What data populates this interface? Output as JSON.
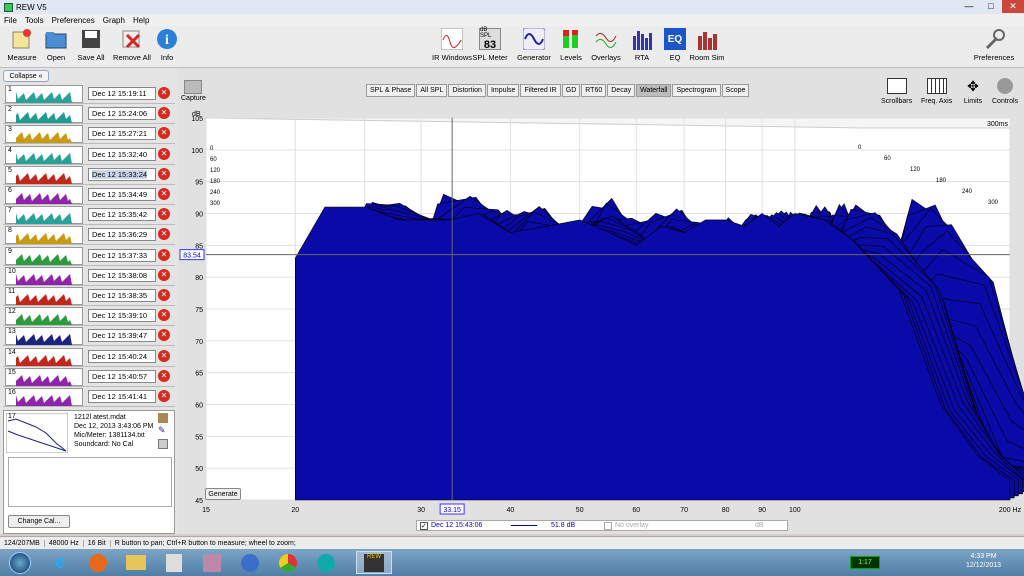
{
  "window": {
    "title": "REW V5",
    "min": "—",
    "max": "□",
    "close": "✕"
  },
  "menu": [
    "File",
    "Tools",
    "Preferences",
    "Graph",
    "Help"
  ],
  "toolbar_left": [
    {
      "label": "Measure",
      "icon": "measure-icon"
    },
    {
      "label": "Open",
      "icon": "folder-open-icon"
    },
    {
      "label": "Save All",
      "icon": "save-icon"
    },
    {
      "label": "Remove All",
      "icon": "remove-all-icon"
    },
    {
      "label": "Info",
      "icon": "info-icon"
    }
  ],
  "toolbar_center": [
    {
      "label": "IR Windows",
      "icon": "ir-windows-icon"
    },
    {
      "label": "SPL Meter",
      "icon": "spl-meter-icon",
      "display_top": "dB SPL",
      "display_val": "83"
    },
    {
      "label": "Generator",
      "icon": "generator-icon"
    },
    {
      "label": "Levels",
      "icon": "levels-icon"
    },
    {
      "label": "Overlays",
      "icon": "overlays-icon"
    },
    {
      "label": "RTA",
      "icon": "rta-icon"
    },
    {
      "label": "EQ",
      "icon": "eq-icon"
    },
    {
      "label": "Room Sim",
      "icon": "room-sim-icon"
    }
  ],
  "preferences_label": "Preferences",
  "collapse_label": "Collapse",
  "measurements": [
    {
      "num": "1",
      "time": "Dec 12 15:19:11",
      "color": "#2aa198"
    },
    {
      "num": "2",
      "time": "Dec 12 15:24:06",
      "color": "#1f9c8f"
    },
    {
      "num": "3",
      "time": "Dec 12 15:27:21",
      "color": "#c79a12"
    },
    {
      "num": "4",
      "time": "Dec 12 15:32:40",
      "color": "#2aa198"
    },
    {
      "num": "5",
      "time": "Dec 12 15:33:24",
      "color": "#c2271c"
    },
    {
      "num": "6",
      "time": "Dec 12 15:34:49",
      "color": "#8e24aa"
    },
    {
      "num": "7",
      "time": "Dec 12 15:35:42",
      "color": "#2aa198"
    },
    {
      "num": "8",
      "time": "Dec 12 15:36:29",
      "color": "#c79a12"
    },
    {
      "num": "9",
      "time": "Dec 12 15:37:33",
      "color": "#2e9a3f"
    },
    {
      "num": "10",
      "time": "Dec 12 15:38:08",
      "color": "#8e24aa"
    },
    {
      "num": "11",
      "time": "Dec 12 15:38:35",
      "color": "#c2271c"
    },
    {
      "num": "12",
      "time": "Dec 12 15:39:10",
      "color": "#2e9a3f"
    },
    {
      "num": "13",
      "time": "Dec 12 15:39:47",
      "color": "#1a237e"
    },
    {
      "num": "14",
      "time": "Dec 12 15:40:24",
      "color": "#c2271c"
    },
    {
      "num": "15",
      "time": "Dec 12 15:40:57",
      "color": "#8e24aa"
    },
    {
      "num": "16",
      "time": "Dec 12 15:41:41",
      "color": "#8e24aa"
    },
    {
      "num": "17",
      "time": "Dec 12 15:43:06",
      "color": "#1a237e"
    }
  ],
  "selected_info": {
    "num": "17",
    "file": "1212l atest.mdat",
    "date": "Dec 12, 2013 3:43:06 PM",
    "mic": "Mic/Meter: 1381134.txt",
    "soundcard": "Soundcard: No Cal",
    "change_cal": "Change Cal..."
  },
  "capture_label": "Capture",
  "tabs": [
    "SPL & Phase",
    "All SPL",
    "Distortion",
    "Impulse",
    "Filtered IR",
    "GD",
    "RT60",
    "Decay",
    "Waterfall",
    "Spectrogram",
    "Scope"
  ],
  "active_tab": "Waterfall",
  "right_tools": [
    {
      "label": "Scrollbars",
      "icon": "scrollbars-icon"
    },
    {
      "label": "Freq. Axis",
      "icon": "freq-axis-icon"
    },
    {
      "label": "Limits",
      "icon": "limits-icon"
    },
    {
      "label": "Controls",
      "icon": "controls-icon"
    }
  ],
  "chart_data": {
    "type": "area",
    "subtype": "waterfall",
    "ylabel": "dB",
    "ylim": [
      45,
      105
    ],
    "yticks": [
      "105",
      "100",
      "95",
      "90",
      "85",
      "80",
      "75",
      "70",
      "65",
      "60",
      "55",
      "50",
      "45"
    ],
    "xscale": "log",
    "xlim": [
      15,
      200
    ],
    "xticks": [
      "15",
      "20",
      "",
      "30",
      "40",
      "50",
      "60",
      "70",
      "80",
      "90",
      "100",
      "200 Hz"
    ],
    "time_labels": [
      "0",
      "60",
      "120",
      "180",
      "240",
      "300"
    ],
    "time_max_label": "300ms",
    "cursor_x_label": "33.15",
    "cursor_y_label": "83.54",
    "slice_color": "#0a0aa8",
    "front_slice": {
      "x": [
        20,
        22,
        25,
        28,
        30,
        33,
        36,
        40,
        45,
        50,
        55,
        60,
        65,
        70,
        75,
        80,
        85,
        90,
        95,
        100,
        110,
        120,
        140,
        160,
        180,
        200
      ],
      "y": [
        83,
        91,
        91,
        89,
        89,
        89,
        90,
        87,
        88,
        89,
        87,
        85,
        88,
        87,
        89,
        89,
        88,
        90,
        88,
        90,
        89,
        86,
        78,
        60,
        52,
        48
      ]
    }
  },
  "generate_label": "Generate",
  "legend": {
    "name": "Dec 12 15:43:06",
    "value": "51.8 dB",
    "overlay": "No overlay",
    "overlay_unit": "dB"
  },
  "status": [
    "124/207MB",
    "48000 Hz",
    "16 Bit",
    "R button to pan; Ctrl+R button to measure; wheel to zoom;"
  ],
  "taskbar": {
    "time": "4:33 PM",
    "date": "12/12/2013",
    "battery": "1:17"
  }
}
